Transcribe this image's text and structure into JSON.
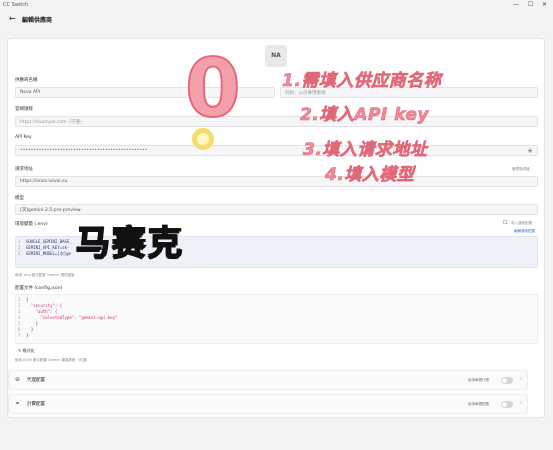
{
  "window": {
    "app_name": "CC Switch",
    "controls": [
      "—",
      "☐",
      "✕"
    ]
  },
  "header": {
    "back_icon": "arrow-left-icon",
    "title": "編輯供應商"
  },
  "logo_placeholder": "NA",
  "form": {
    "name": {
      "label": "供應商名稱",
      "value": "Nova API"
    },
    "note": {
      "placeholder": "例如：公司專用帳號"
    },
    "website": {
      "label": "官網鏈接",
      "placeholder": "https://example.com（可選）"
    },
    "api_key": {
      "label": "API Key",
      "value": "••••••••••••••••••••••••••••••••••••••••••••••••"
    },
    "endpoint": {
      "label": "請求地址",
      "value": "https://once.novai.su",
      "action": "管理與測速"
    },
    "model": {
      "label": "模型",
      "value": "[次]gemini-2.5-pro-preview"
    },
    "env": {
      "label": "環境變量 (.env)",
      "checkbox_label": "寫入通用配置",
      "edit_link": "編輯通用配置",
      "lines": [
        {
          "num": "1",
          "text": "GOOGLE_GEMINI_BASE_"
        },
        {
          "num": "2",
          "text": "GEMINI_API_KEY=sk-"
        },
        {
          "num": "3",
          "text": "GEMINI_MODEL=[次]ge"
        }
      ],
      "hint": "使用 .env 格式配置 Gemini 環境變量"
    },
    "config": {
      "label": "配置文件 (config.json)",
      "lines": [
        {
          "num": "1",
          "text": "{"
        },
        {
          "num": "2",
          "text": "  \"security\": {"
        },
        {
          "num": "3",
          "text": "    \"auth\": {"
        },
        {
          "num": "4",
          "text": "      \"selectedType\": \"gemini-api-key\""
        },
        {
          "num": "5",
          "text": "    }"
        },
        {
          "num": "6",
          "text": "  }"
        },
        {
          "num": "7",
          "text": "}"
        }
      ],
      "format_label": "格式化",
      "hint": "使用 JSON 格式配置 Gemini 擴展參數（可選）"
    }
  },
  "rows": [
    {
      "icon": "globe-icon",
      "title": "代理配置",
      "status": "使用單獨代理"
    },
    {
      "icon": "link-icon",
      "title": "計費配置",
      "status": "使用單獨配置"
    }
  ],
  "annotations": {
    "step1": "1.需填入供应商名称",
    "step2": "2.填入API key",
    "step3": "3.填入请求地址",
    "step4": "4.填入模型",
    "zero": "0",
    "brand_text": "马赛克"
  },
  "colors": {
    "annotation_pink": "#f08a9a",
    "annotation_yellow": "#f3de6a",
    "code_bg": "#eef1f8"
  }
}
